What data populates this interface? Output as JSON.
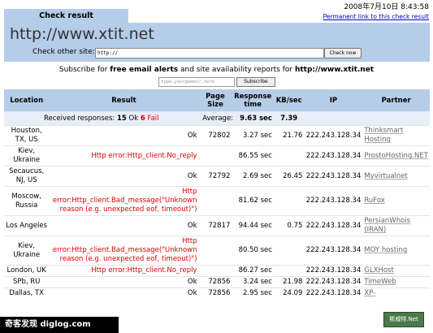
{
  "tab_label": "Check result",
  "timestamp": "2008年7月10日  8:43:58",
  "permalink": "Permanent link to this check result",
  "header_url": "http://www.xtit.net",
  "check_other_label": "Check other site:",
  "check_other_value": "http://",
  "check_button": "Check now",
  "subscribe_text_pre": "Subscribe for ",
  "subscribe_bold1": "free email alerts",
  "subscribe_text_mid": " and site availability reports for ",
  "subscribe_bold2": "http://www.xtit.net",
  "email_placeholder": "type.your@email.here",
  "subscribe_button": "Subscribe",
  "columns": [
    "Location",
    "Result",
    "Page Size",
    "Response time",
    "KB/sec",
    "IP",
    "Partner"
  ],
  "summary": {
    "label": "Received responses:",
    "count": "15",
    "ok": "Ok",
    "fail_count": "6",
    "fail": "Fail",
    "avg_label": "Average:",
    "avg_time": "9.63 sec",
    "avg_kb": "7.39"
  },
  "rows": [
    {
      "loc": "Houston, TX, US",
      "res": "Ok",
      "err": false,
      "size": "72802",
      "time": "3.27 sec",
      "kb": "21.76",
      "ip": "222.243.128.34",
      "partner": "Thinksmart Hosting"
    },
    {
      "loc": "Kiev, Ukraine",
      "res": "Http error:Http_client.No_reply",
      "err": true,
      "size": "",
      "time": "86.55 sec",
      "kb": "",
      "ip": "222.243.128.34",
      "partner": "ProstoHosting.NET"
    },
    {
      "loc": "Secaucus, NJ, US",
      "res": "Ok",
      "err": false,
      "size": "72792",
      "time": "2.69 sec",
      "kb": "26.45",
      "ip": "222.243.128.34",
      "partner": "Myvirtualnet"
    },
    {
      "loc": "Moscow, Russia",
      "res": "Http error:Http_client.Bad_message(\"Unknown reason (e.g. unexpected eof, timeout)\")",
      "err": true,
      "size": "",
      "time": "81.62 sec",
      "kb": "",
      "ip": "222.243.128.34",
      "partner": "RuFox"
    },
    {
      "loc": "Los Angeles",
      "res": "Ok",
      "err": false,
      "size": "72817",
      "time": "94.44 sec",
      "kb": "0.75",
      "ip": "222.243.128.34",
      "partner": "PersianWhois (IRAN)"
    },
    {
      "loc": "Kiev, Ukraine",
      "res": "Http error:Http_client.Bad_message(\"Unknown reason (e.g. unexpected eof, timeout)\")",
      "err": true,
      "size": "",
      "time": "80.50 sec",
      "kb": "",
      "ip": "222.243.128.34",
      "partner": "MOY hosting"
    },
    {
      "loc": "London, UK",
      "res": "Http error:Http_client.No_reply",
      "err": true,
      "size": "",
      "time": "86.27 sec",
      "kb": "",
      "ip": "222.243.128.34",
      "partner": "GLXHost"
    },
    {
      "loc": "SPb, RU",
      "res": "Ok",
      "err": false,
      "size": "72856",
      "time": "3.24 sec",
      "kb": "21.98",
      "ip": "222.243.128.34",
      "partner": "TimeWeb"
    },
    {
      "loc": "Dallas, TX",
      "res": "Ok",
      "err": false,
      "size": "72856",
      "time": "2.95 sec",
      "kb": "24.09",
      "ip": "222.243.128.34",
      "partner": "XP-"
    }
  ],
  "footer_watermark": "奇客发现  diglog.com",
  "badge_text": "斯威特.Net"
}
